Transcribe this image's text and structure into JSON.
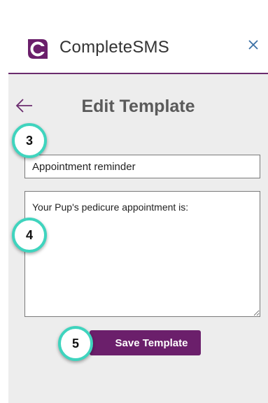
{
  "header": {
    "brand": "CompleteSMS",
    "logo_icon": "completesms-logo-icon",
    "close_icon": "close-icon",
    "brand_color": "#6b1f6b"
  },
  "page": {
    "back_icon": "arrow-left-icon",
    "title": "Edit Template"
  },
  "form": {
    "template_name_value": "Appointment reminder",
    "template_body_value": "Your Pup's pedicure appointment is:",
    "save_label": "Save Template"
  },
  "markers": {
    "step_3": "3",
    "step_4": "4",
    "step_5": "5",
    "marker_color": "#3fd4be"
  }
}
